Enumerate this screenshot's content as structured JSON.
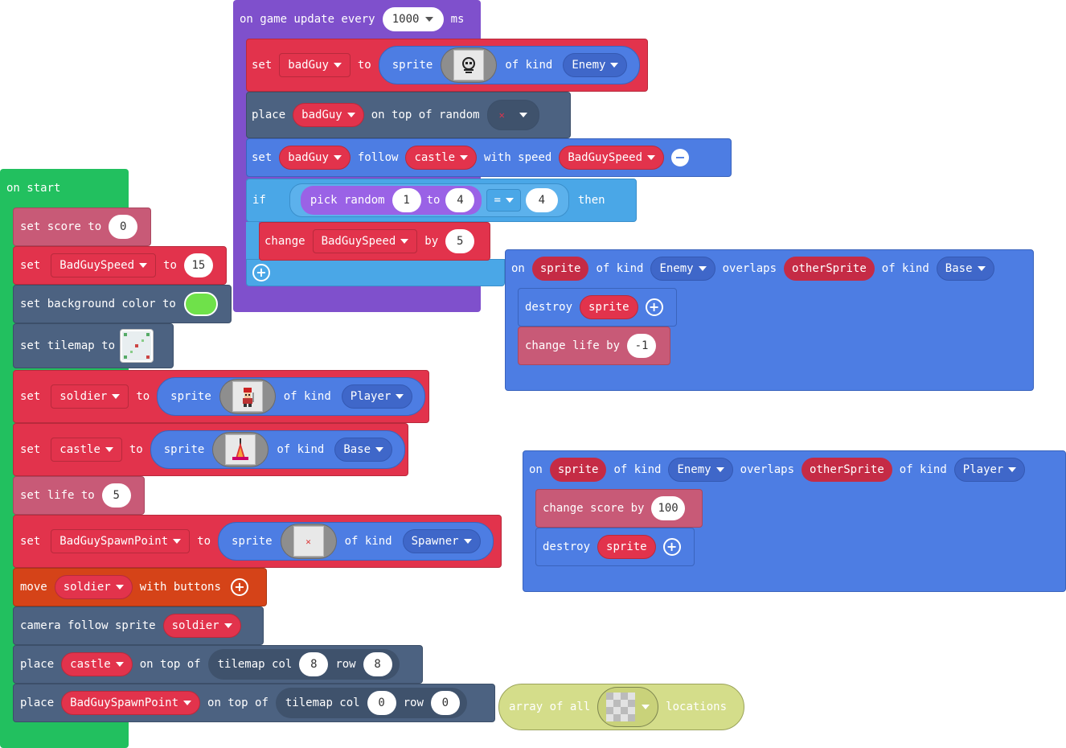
{
  "game_update": {
    "header": {
      "on": "on game update every",
      "interval": "1000",
      "unit": "ms"
    },
    "set_badguy": {
      "set": "set",
      "var": "badGuy",
      "to": "to",
      "sprite": "sprite",
      "of_kind": "of kind",
      "kind": "Enemy"
    },
    "place": {
      "place": "place",
      "var": "badGuy",
      "text": "on top of random"
    },
    "follow": {
      "set": "set",
      "var": "badGuy",
      "follow": "follow",
      "target": "castle",
      "with_speed": "with speed",
      "speed": "BadGuySpeed"
    },
    "if": {
      "if": "if",
      "pick": "pick random",
      "from": "1",
      "to": "to",
      "max": "4",
      "op": "=",
      "value": "4",
      "then": "then"
    },
    "change": {
      "change": "change",
      "var": "BadGuySpeed",
      "by": "by",
      "value": "5"
    }
  },
  "on_start": {
    "header": "on start",
    "score": {
      "text": "set score to",
      "value": "0"
    },
    "speed": {
      "set": "set",
      "var": "BadGuySpeed",
      "to": "to",
      "value": "15"
    },
    "bg": {
      "text": "set background color to",
      "color": "#6fe14a"
    },
    "tilemap": {
      "text": "set tilemap to"
    },
    "soldier": {
      "set": "set",
      "var": "soldier",
      "to": "to",
      "sprite": "sprite",
      "of_kind": "of kind",
      "kind": "Player"
    },
    "castle": {
      "set": "set",
      "var": "castle",
      "to": "to",
      "sprite": "sprite",
      "of_kind": "of kind",
      "kind": "Base"
    },
    "life": {
      "text": "set life to",
      "value": "5"
    },
    "spawn": {
      "set": "set",
      "var": "BadGuySpawnPoint",
      "to": "to",
      "sprite": "sprite",
      "of_kind": "of kind",
      "kind": "Spawner"
    },
    "move": {
      "move": "move",
      "var": "soldier",
      "text": "with buttons"
    },
    "camera": {
      "text": "camera follow sprite",
      "var": "soldier"
    },
    "place_castle": {
      "place": "place",
      "var": "castle",
      "on_top": "on top of",
      "tilemap": "tilemap col",
      "col": "8",
      "row": "row",
      "row_val": "8"
    },
    "place_spawn": {
      "place": "place",
      "var": "BadGuySpawnPoint",
      "on_top": "on top of",
      "tilemap": "tilemap col",
      "col": "0",
      "row": "row",
      "row_val": "0"
    }
  },
  "overlap1": {
    "on": "on",
    "sprite": "sprite",
    "of_kind": "of kind",
    "kind": "Enemy",
    "overlaps": "overlaps",
    "other": "otherSprite",
    "of_kind2": "of kind",
    "kind2": "Base",
    "destroy": {
      "text": "destroy",
      "var": "sprite"
    },
    "life": {
      "text": "change life by",
      "value": "-1"
    }
  },
  "overlap2": {
    "on": "on",
    "sprite": "sprite",
    "of_kind": "of kind",
    "kind": "Enemy",
    "overlaps": "overlaps",
    "other": "otherSprite",
    "of_kind2": "of kind",
    "kind2": "Player",
    "score": {
      "text": "change score by",
      "value": "100"
    },
    "destroy": {
      "text": "destroy",
      "var": "sprite"
    }
  },
  "array_block": {
    "text": "array of all",
    "suffix": "locations"
  },
  "colors": {
    "events": "#22c05f",
    "sprites": "#4d7de3",
    "variables": "#e2334c",
    "scene": "#4c6281",
    "info": "#c85a77",
    "loops": "#7f50cc",
    "logic": "#4aa7e7",
    "controller": "#d54318",
    "ghost": "#d4dd8a"
  }
}
